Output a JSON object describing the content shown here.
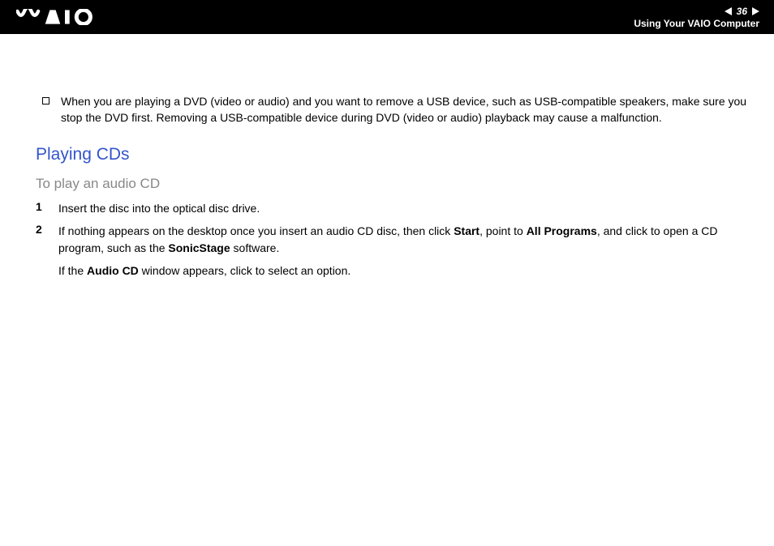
{
  "header": {
    "page_number": "36",
    "section_title": "Using Your VAIO Computer"
  },
  "bullet": {
    "text": "When you are playing a DVD (video or audio) and you want to remove a USB device, such as USB-compatible speakers, make sure you stop the DVD first. Removing a USB-compatible device during DVD (video or audio) playback may cause a malfunction."
  },
  "section": {
    "heading": "Playing CDs",
    "subheading": "To play an audio CD"
  },
  "steps": {
    "step1_num": "1",
    "step1_text": "Insert the disc into the optical disc drive.",
    "step2_num": "2",
    "step2_pre": "If nothing appears on the desktop once you insert an audio CD disc, then click ",
    "step2_bold1": "Start",
    "step2_mid1": ", point to ",
    "step2_bold2": "All Programs",
    "step2_mid2": ", and click to open a CD program, such as the ",
    "step2_bold3": "SonicStage",
    "step2_end": " software.",
    "follow_pre": "If the ",
    "follow_bold": "Audio CD",
    "follow_end": " window appears, click to select an option."
  }
}
